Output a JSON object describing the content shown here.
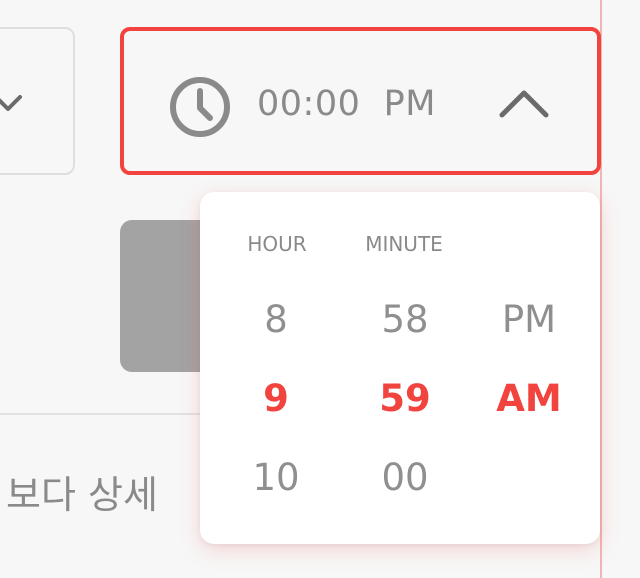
{
  "time_picker": {
    "value": "00:00  PM",
    "icon": "clock-icon",
    "toggle_icon": "chevron-up-icon",
    "accent_color": "#f1443f",
    "columns": [
      {
        "header": "HOUR",
        "items": [
          "8",
          "9",
          "10"
        ],
        "selected": "9"
      },
      {
        "header": "MINUTE",
        "items": [
          "58",
          "59",
          "00"
        ],
        "selected": "59"
      },
      {
        "header": "",
        "items": [
          "PM",
          "AM"
        ],
        "selected": "AM"
      }
    ]
  },
  "left_field": {
    "icon": "chevron-down-icon"
  },
  "background_text": "보다 상세"
}
